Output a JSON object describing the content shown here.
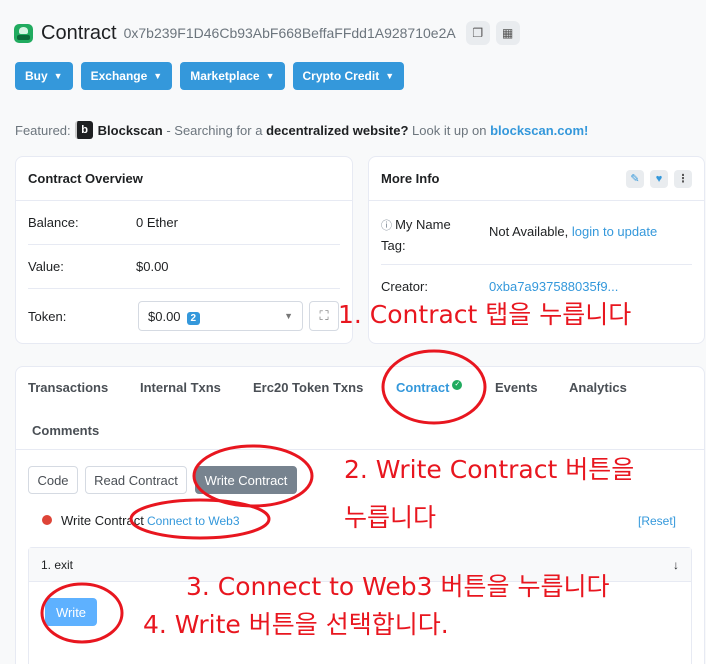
{
  "header": {
    "title": "Contract",
    "address": "0x7b239F1D46Cb93AbF668BeffaFFdd1A928710e2A",
    "copy_icon": "copy-icon",
    "qr_icon": "qr-icon"
  },
  "menubar": [
    "Buy",
    "Exchange",
    "Marketplace",
    "Crypto Credit"
  ],
  "featured": {
    "label": "Featured:",
    "brand": "Blockscan",
    "text1": "- Searching for a",
    "bold": "decentralized website?",
    "text2": "Look it up on",
    "link": "blockscan.com!"
  },
  "overview": {
    "title": "Contract Overview",
    "balance_label": "Balance:",
    "balance_value": "0 Ether",
    "value_label": "Value:",
    "value_value": "$0.00",
    "token_label": "Token:",
    "token_value": "$0.00",
    "token_count": "2"
  },
  "more_info": {
    "title": "More Info",
    "name_tag_label1": "My Name",
    "name_tag_label2": "Tag:",
    "name_tag_value": "Not Available,",
    "name_tag_link": "login to update",
    "creator_label": "Creator:",
    "creator_value": "0xba7a937588035f9..."
  },
  "tabs": [
    "Transactions",
    "Internal Txns",
    "Erc20 Token Txns",
    "Contract",
    "Events",
    "Analytics",
    "Comments"
  ],
  "subtabs": [
    "Code",
    "Read Contract",
    "Write Contract"
  ],
  "write": {
    "label": "Write Contract",
    "connect": "Connect to Web3",
    "reset": "[Reset]",
    "method": "1. exit",
    "button": "Write"
  },
  "annotations": {
    "step1": "1. Contract 탭을 누릅니다",
    "step2a": "2. Write Contract 버튼을",
    "step2b": "누릅니다",
    "step3": "3. Connect to Web3 버튼을 누릅니다",
    "step4": "4. Write 버튼을 선택합니다."
  },
  "colors": {
    "accent": "#3498db",
    "annotation": "#e8161f",
    "success": "#21ab5f"
  }
}
